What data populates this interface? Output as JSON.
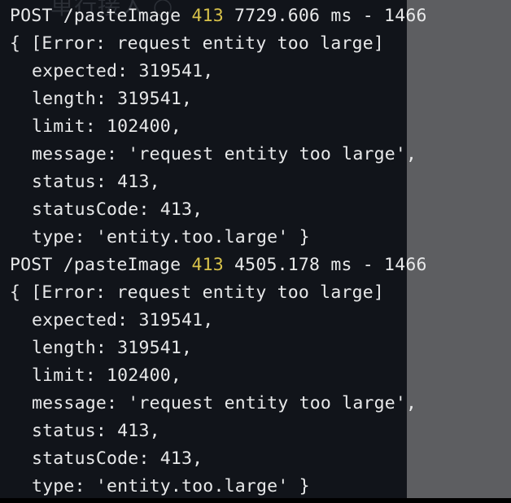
{
  "ghost_title": "单行接入 ○",
  "entries": [
    {
      "method_path": "POST /pasteImage ",
      "status_code": "413",
      "timing": " 7729.606 ms - 1466",
      "error_head": "{ [Error: request entity too large]",
      "expected": "expected: 319541,",
      "length": "length: 319541,",
      "limit": "limit: 102400,",
      "message": "message: 'request entity too large',",
      "status": "status: 413,",
      "statusCode": "statusCode: 413,",
      "type": "type: 'entity.too.large' }"
    },
    {
      "method_path": "POST /pasteImage ",
      "status_code": "413",
      "timing": " 4505.178 ms - 1466",
      "error_head": "{ [Error: request entity too large]",
      "expected": "expected: 319541,",
      "length": "length: 319541,",
      "limit": "limit: 102400,",
      "message": "message: 'request entity too large',",
      "status": "status: 413,",
      "statusCode": "statusCode: 413,",
      "type": "type: 'entity.too.large' }"
    }
  ],
  "colors": {
    "terminal_bg": "#11141a",
    "text": "#e8e9ea",
    "status_code": "#d8c24a",
    "side_panel": "#5d5e61"
  }
}
